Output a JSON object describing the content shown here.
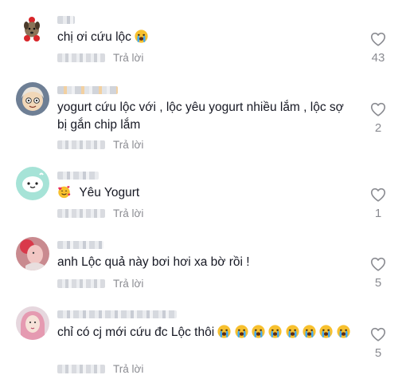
{
  "reply_label": "Trả lời",
  "comments": [
    {
      "text": "chị ơi cứu lộc",
      "meta_suffix": "r...",
      "likes": "43"
    },
    {
      "text": "yogurt cứu lộc với , lộc yêu yogurt nhiều lắm , lộc sợ bị gắn chip lắm",
      "meta_suffix": "...",
      "likes": "2"
    },
    {
      "text": "Yêu Yogurt",
      "meta_suffix": "...",
      "likes": "1"
    },
    {
      "text": "anh Lộc quả này bơi hơi xa bờ rồi !",
      "meta_suffix": "",
      "likes": "5"
    },
    {
      "text": "chỉ có cj mới cứu đc Lộc thôi",
      "meta_suffix": "",
      "likes": "5"
    }
  ],
  "icons": {
    "heart": "heart-outline-icon",
    "crying": "crying-emoji-icon",
    "love": "smiling-hearts-emoji-icon"
  },
  "colors": {
    "text": "#161823",
    "secondary": "#8a8b91",
    "heart_stroke": "#8a8b91"
  }
}
